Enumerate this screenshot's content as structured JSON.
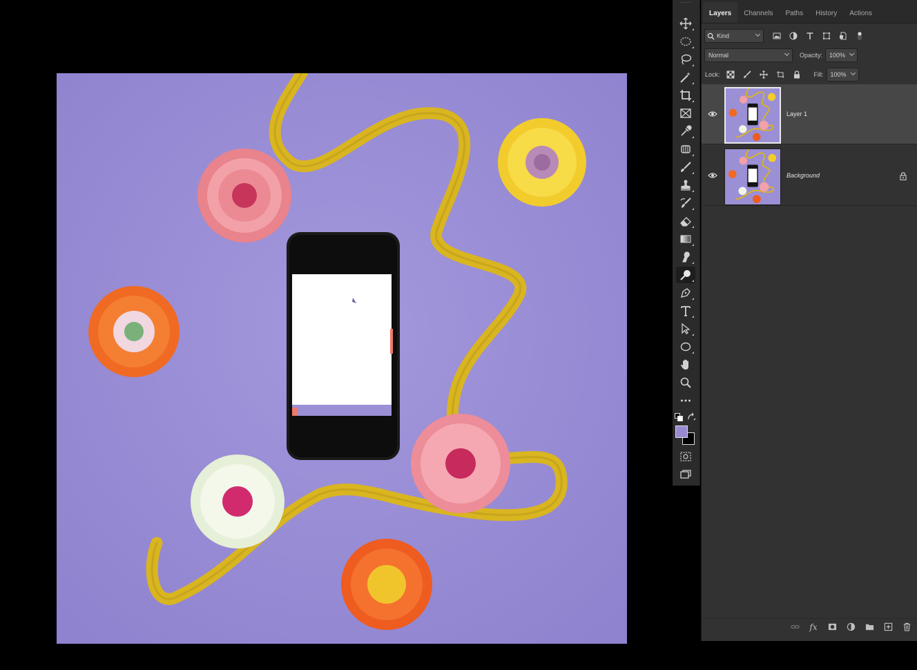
{
  "panel": {
    "tabs": [
      {
        "label": "Layers"
      },
      {
        "label": "Channels"
      },
      {
        "label": "Paths"
      },
      {
        "label": "History"
      },
      {
        "label": "Actions"
      }
    ],
    "filter_kind": "Kind",
    "blend_mode": "Normal",
    "opacity_label": "Opacity:",
    "opacity_value": "100%",
    "lock_label": "Lock:",
    "fill_label": "Fill:",
    "fill_value": "100%",
    "layers": [
      {
        "name": "Layer 1",
        "visible": true,
        "selected": true,
        "locked": false
      },
      {
        "name": "Background",
        "visible": true,
        "selected": false,
        "locked": true
      }
    ]
  },
  "toolbar": {
    "tools": [
      "move-tool-icon",
      "elliptical-marquee-icon",
      "lasso-icon",
      "magic-wand-icon",
      "crop-icon",
      "frame-icon",
      "eyedropper-icon",
      "spot-healing-icon",
      "brush-icon",
      "clone-stamp-icon",
      "history-brush-icon",
      "eraser-icon",
      "gradient-icon",
      "smudge-icon",
      "dodge-icon",
      "pen-icon",
      "type-icon",
      "path-selection-icon",
      "ellipse-shape-icon",
      "hand-icon",
      "zoom-icon",
      "more-tools-icon"
    ],
    "active_tool": "dodge-icon",
    "foreground_color": "#9a8bd0",
    "background_color": "#000000"
  },
  "colors": {
    "canvas_bg": "#9b8fd6",
    "ribbon": "#d9b520",
    "panel_bg": "#323232"
  }
}
